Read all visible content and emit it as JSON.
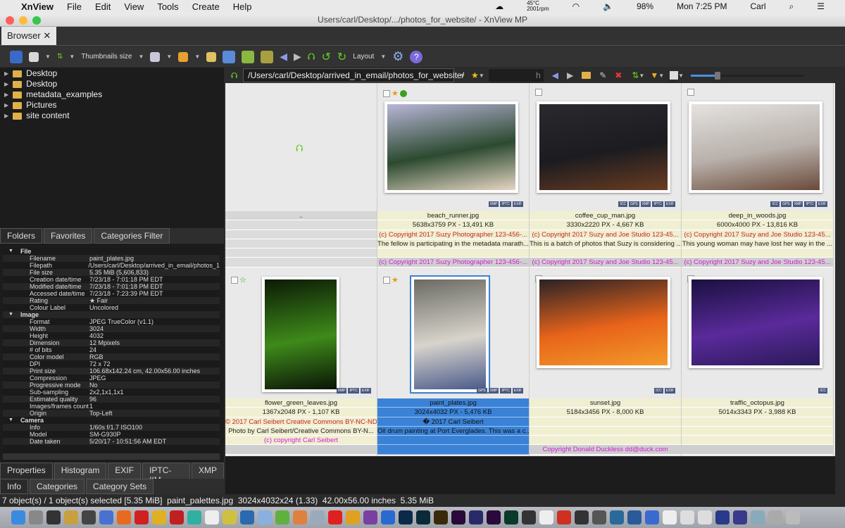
{
  "menubar": {
    "items": [
      "XnView",
      "File",
      "Edit",
      "View",
      "Tools",
      "Create",
      "Help"
    ],
    "temp": "45°C",
    "rpm": "2001rpm",
    "battery": "98%",
    "clock": "Mon 7:25 PM",
    "user": "Carl"
  },
  "window": {
    "title": "Users/carl/Desktop/.../photos_for_website/ - XnView MP",
    "tab": "Browser",
    "tab_close": "✕"
  },
  "toolbar": {
    "thumb_size": "Thumbnails size",
    "layout": "Layout"
  },
  "tree": [
    "Desktop",
    "Desktop",
    "metadata_examples",
    "Pictures",
    "site content"
  ],
  "left_tabs": [
    "Folders",
    "Favorites",
    "Categories Filter"
  ],
  "info": [
    {
      "section": "File"
    },
    {
      "k": "Filename",
      "v": "paint_plates.jpg"
    },
    {
      "k": "Filepath",
      "v": "/Users/carl/Desktop/arrived_in_email/photos_1"
    },
    {
      "k": "File size",
      "v": "5.35 MiB (5,606,833)"
    },
    {
      "k": "Creation date/time",
      "v": "7/23/18 - 7:01:18 PM EDT"
    },
    {
      "k": "Modified date/time",
      "v": "7/23/18 - 7:01:18 PM EDT"
    },
    {
      "k": "Accessed date/time",
      "v": "7/23/18 - 7:23:39 PM EDT"
    },
    {
      "k": "Rating",
      "v": "★ Fair"
    },
    {
      "k": "Colour Label",
      "v": "Uncolored"
    },
    {
      "section": "Image"
    },
    {
      "k": "Format",
      "v": "JPEG TrueColor (v1.1)"
    },
    {
      "k": "Width",
      "v": "3024"
    },
    {
      "k": "Height",
      "v": "4032"
    },
    {
      "k": "Dimension",
      "v": "12 Mpixels"
    },
    {
      "k": "# of bits",
      "v": "24"
    },
    {
      "k": "Color model",
      "v": "RGB"
    },
    {
      "k": "DPI",
      "v": "72 x 72"
    },
    {
      "k": "Print size",
      "v": "106.68x142.24 cm, 42.00x56.00 inches"
    },
    {
      "k": "Compression",
      "v": "JPEG"
    },
    {
      "k": "Progressive mode",
      "v": "No"
    },
    {
      "k": "Sub-sampling",
      "v": "2x2,1x1,1x1"
    },
    {
      "k": "Estimated quality",
      "v": "96"
    },
    {
      "k": "Images/frames count",
      "v": "1"
    },
    {
      "k": "Origin",
      "v": "Top-Left"
    },
    {
      "section": "Camera"
    },
    {
      "k": "Info",
      "v": "1/60s f/1.7 ISO100"
    },
    {
      "k": "Model",
      "v": "SM-G930P"
    },
    {
      "k": "Date taken",
      "v": "5/20/17 - 10:51:56 AM EDT"
    }
  ],
  "bottom_tabs1": [
    "Properties",
    "Histogram",
    "EXIF",
    "IPTC-IIM",
    "XMP"
  ],
  "bottom_tabs2": [
    "Info",
    "Categories",
    "Category Sets"
  ],
  "path": "/Users/carl/Desktop/arrived_in_email/photos_for_website/",
  "search_value": "h",
  "parent": {
    "label": ".."
  },
  "files": [
    {
      "name": "beach_runner.jpg",
      "dims": "5638x3759 PX - 13,491 KB",
      "l3": "(c) Copyright 2017 Suzy Photographer  123-456-...",
      "l4": "The fellow is participating in the metadata marath...",
      "l5": "",
      "l6": "(c) Copyright 2017 Suzy Photographer  123-456-...",
      "badges": [
        "XMP",
        "IPTC",
        "EXIF"
      ],
      "rating": true,
      "label_color": "#3aa020",
      "colors": [
        "#b9b6d8",
        "#2c4a30",
        "#e6d6c4"
      ]
    },
    {
      "name": "coffee_cup_man.jpg",
      "dims": "3330x2220 PX - 4,667 KB",
      "l3": "(c) Copyright 2017 Suzy and Joe Studio  123-45...",
      "l4": "This is a batch of photos that Suzy is considering ...",
      "l5": "",
      "l6": "(c) Copyright 2017 Suzy and Joe Studio  123-45...",
      "badges": [
        "ICC",
        "GPS",
        "XMP",
        "IPTC",
        "EXIF"
      ],
      "colors": [
        "#2a2a2e",
        "#1c1c20",
        "#6a3c22"
      ]
    },
    {
      "name": "deep_in_woods.jpg",
      "dims": "6000x4000 PX - 13,816 KB",
      "l3": "(c) Copyright 2017 Suzy and Joe Studio  123-45...",
      "l4": "This young woman may have lost her way in the ...",
      "l5": "",
      "l6": "(c) Copyright 2017 Suzy and Joe Studio  123-45...",
      "badges": [
        "ICC",
        "GPS",
        "XMP",
        "IPTC",
        "EXIF"
      ],
      "colors": [
        "#e4e2e0",
        "#b8b0aa",
        "#6a4a3a"
      ]
    },
    {
      "name": "flower_green_leaves.jpg",
      "dims": "1367x2048 PX - 1,107 KB",
      "l3": "© 2017 Carl Seibert Creative Commons BY-NC-ND...",
      "l4": "Photo by Carl Seibert/Creative Commons BY-N...",
      "l5": "(c) copyright Carl Seibert",
      "l6": "",
      "badges": [
        "XMP",
        "IPTC",
        "EXIF"
      ],
      "star_outline": true,
      "colors": [
        "#0c1a06",
        "#3e8a1a",
        "#0a1406"
      ]
    },
    {
      "name": "paint_plates.jpg",
      "dims": "3024x4032 PX - 5,476 KB",
      "l3": "� 2017 Carl Seibert",
      "l4": "Oil drum painting at Port Everglades. This was a c...",
      "l5": "",
      "l6": "",
      "badges": [
        "GPS",
        "XMP",
        "IPTC",
        "EXIF"
      ],
      "rating": true,
      "selected": true,
      "colors": [
        "#6a6a64",
        "#d8d4cc",
        "#4a5a8a"
      ]
    },
    {
      "name": "sunset.jpg",
      "dims": "5184x3456 PX - 8,000 KB",
      "l3": "",
      "l4": "",
      "l5": "",
      "l6": "Copyright Donald Duckless  dd@duck.com",
      "badges": [
        "ICC",
        "EXIF"
      ],
      "colors": [
        "#2a2226",
        "#e8641a",
        "#f29a2a"
      ]
    },
    {
      "name": "traffic_octopus.jpg",
      "dims": "5014x3343 PX - 3,988 KB",
      "l3": "",
      "l4": "",
      "l5": "",
      "l6": "",
      "badges": [
        "ICC"
      ],
      "colors": [
        "#1a1040",
        "#5a2a9a",
        "#2a1a5a"
      ]
    }
  ],
  "statusbar": "7 object(s) / 1 object(s) selected [5.35 MiB]  paint_palettes.jpg  3024x4032x24 (1.33)  42.00x56.00 inches  5.35 MiB",
  "colors": {
    "selection": "#3a82d6",
    "copyright_red": "#c8281e",
    "copyright_magenta": "#d21ed2"
  }
}
